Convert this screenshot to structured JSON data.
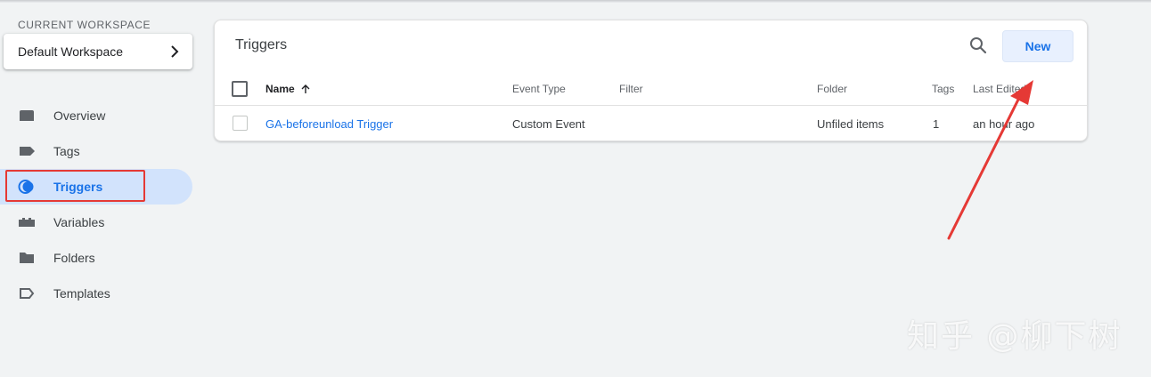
{
  "sidebar": {
    "workspace_label": "CURRENT WORKSPACE",
    "workspace_name": "Default Workspace",
    "items": [
      {
        "label": "Overview",
        "icon": "overview-icon"
      },
      {
        "label": "Tags",
        "icon": "tag-icon"
      },
      {
        "label": "Triggers",
        "icon": "trigger-icon",
        "active": true
      },
      {
        "label": "Variables",
        "icon": "variables-icon"
      },
      {
        "label": "Folders",
        "icon": "folder-icon"
      },
      {
        "label": "Templates",
        "icon": "template-icon"
      }
    ]
  },
  "main": {
    "title": "Triggers",
    "new_button": "New",
    "columns": {
      "name": "Name",
      "event_type": "Event Type",
      "filter": "Filter",
      "folder": "Folder",
      "tags": "Tags",
      "last_edited": "Last Edited"
    },
    "rows": [
      {
        "name": "GA-beforeunload Trigger",
        "event_type": "Custom Event",
        "filter": "",
        "folder": "Unfiled items",
        "tags": "1",
        "last_edited": "an hour ago"
      }
    ]
  },
  "watermark": "知乎 @柳下树",
  "colors": {
    "accent": "#1a73e8",
    "active_nav_bg": "#d2e3fc",
    "annotation_red": "#e53935",
    "page_bg": "#f1f3f4"
  }
}
